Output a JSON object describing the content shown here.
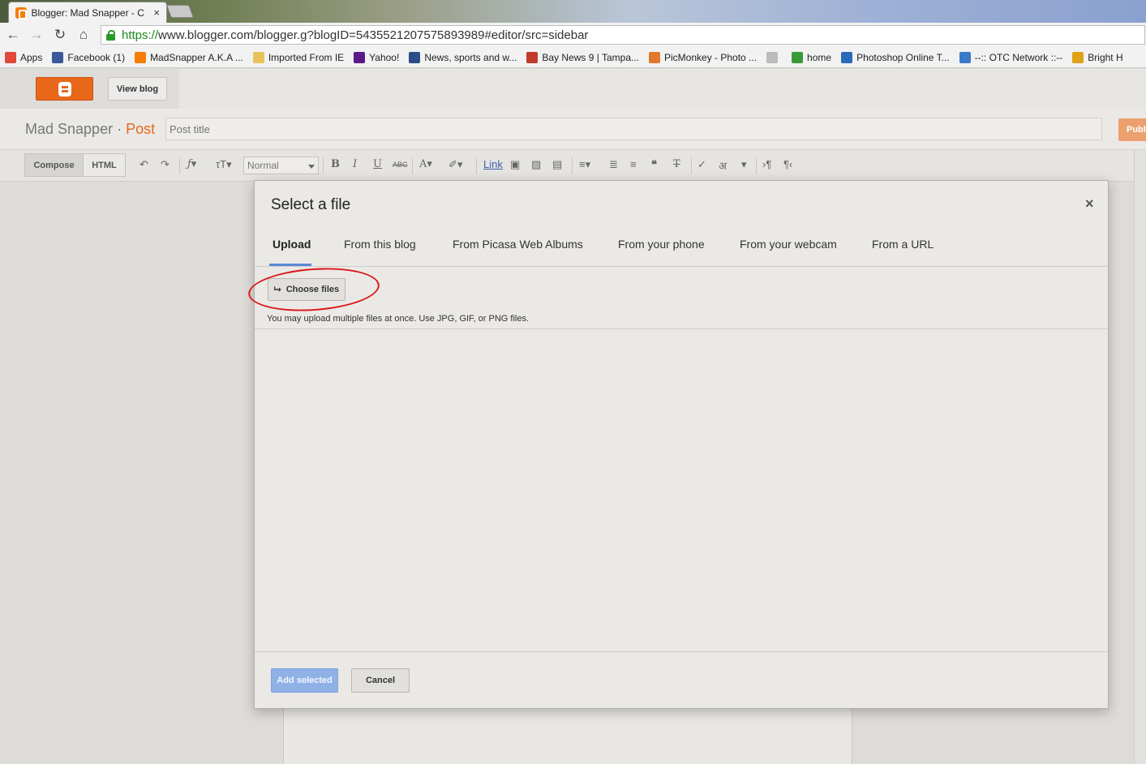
{
  "browser": {
    "tab_title": "Blogger: Mad Snapper - C",
    "tab_close": "×",
    "url_protocol": "https://",
    "url_rest": "www.blogger.com/blogger.g?blogID=5435521207575893989#editor/src=sidebar",
    "bookmarks": [
      {
        "label": "Apps",
        "icon": "apps-grid-icon",
        "color": "#e04a3a"
      },
      {
        "label": "Facebook (1)",
        "icon": "facebook-icon",
        "color": "#3b5998"
      },
      {
        "label": "MadSnapper A.K.A ...",
        "icon": "blogger-icon",
        "color": "#f57d00"
      },
      {
        "label": "Imported From IE",
        "icon": "folder-icon",
        "color": "#e8c35a"
      },
      {
        "label": "Yahoo!",
        "icon": "yahoo-icon",
        "color": "#5a1a8a"
      },
      {
        "label": "News, sports and w...",
        "icon": "bh-icon",
        "color": "#2a4d8a"
      },
      {
        "label": "Bay News 9 | Tampa...",
        "icon": "baynews-icon",
        "color": "#c23b2a"
      },
      {
        "label": "PicMonkey - Photo ...",
        "icon": "picmonkey-icon",
        "color": "#e07a2a"
      },
      {
        "label": "",
        "icon": "page-icon",
        "color": "#bbbbbb"
      },
      {
        "label": "home",
        "icon": "home-diamond-icon",
        "color": "#3a9a3a"
      },
      {
        "label": "Photoshop Online T...",
        "icon": "photoshop-icon",
        "color": "#2a6ab8"
      },
      {
        "label": "--:: OTC Network ::--",
        "icon": "otc-icon",
        "color": "#3a7ac8"
      },
      {
        "label": "Bright H",
        "icon": "bright-icon",
        "color": "#e0a21a"
      }
    ]
  },
  "header": {
    "view_blog": "View blog"
  },
  "post": {
    "blog_name": "Mad Snapper",
    "separator": "·",
    "section": "Post",
    "title_placeholder": "Post title",
    "publish": "Publ"
  },
  "editor": {
    "compose": "Compose",
    "html": "HTML",
    "format": "Normal",
    "link": "Link"
  },
  "dialog": {
    "title": "Select a file",
    "close": "×",
    "tabs": [
      "Upload",
      "From this blog",
      "From Picasa Web Albums",
      "From your phone",
      "From your webcam",
      "From a URL"
    ],
    "choose_files": "Choose files",
    "hint": "You may upload multiple files at once. Use JPG, GIF, or PNG files.",
    "add_selected": "Add selected",
    "cancel": "Cancel"
  },
  "colors": {
    "blogger_orange": "#e8671b",
    "primary_button": "#8fb1e6",
    "annotation_red": "#d91a1a"
  }
}
